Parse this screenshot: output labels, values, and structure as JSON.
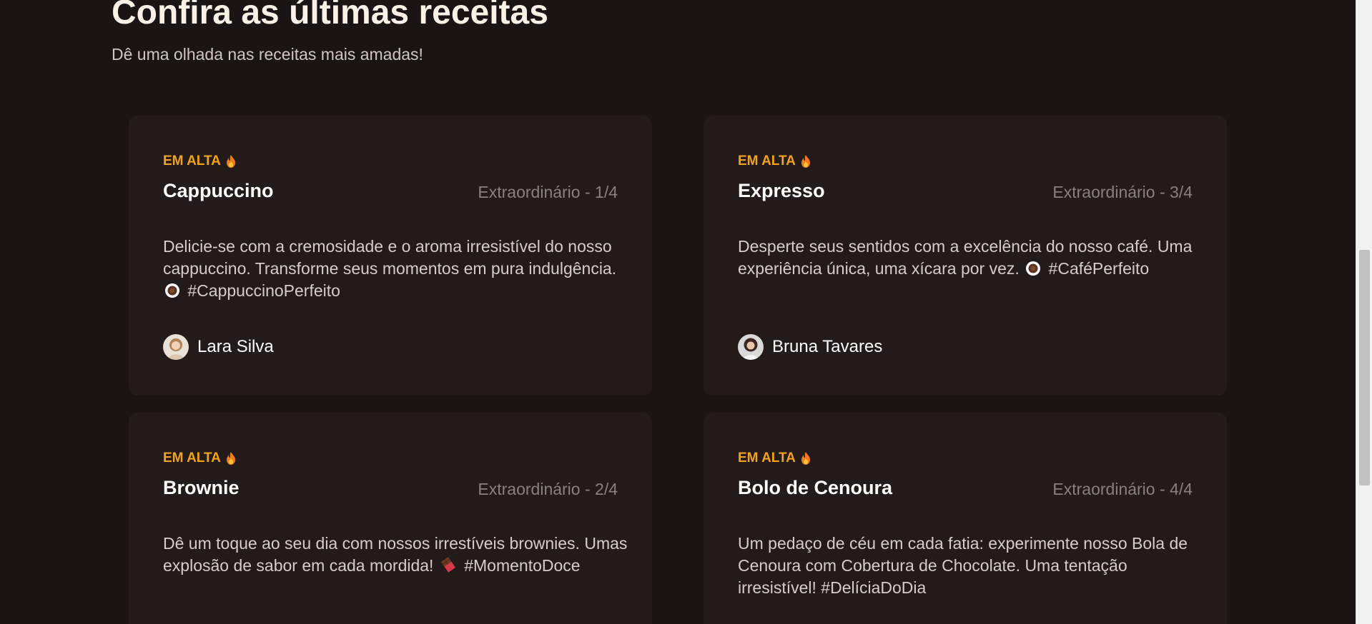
{
  "section": {
    "title": "Confira as últimas receitas",
    "subtitle": "Dê uma olhada nas receitas mais amadas!"
  },
  "colors": {
    "background": "#1b1414",
    "card": "#231a1a",
    "badge": "#f3a21a",
    "title": "#ffffff",
    "muted": "#8a8080"
  },
  "recipes": [
    {
      "badge": "EM ALTA",
      "badge_icon": "flame-icon",
      "title": "Cappuccino",
      "rating": "Extraordinário - 1/4",
      "description_start": "Delicie-se com a cremosidade e o aroma irresistível do nosso cappuccino. Transforme seus momentos em pura indulgência.",
      "emoji_icon": "coffee-cup-icon",
      "hashtag": "#CappuccinoPerfeito",
      "author": "Lara Silva"
    },
    {
      "badge": "EM ALTA",
      "badge_icon": "flame-icon",
      "title": "Expresso",
      "rating": "Extraordinário - 3/4",
      "description_start": "Desperte seus sentidos com a excelência do nosso café. Uma experiência única, uma xícara por vez.",
      "emoji_icon": "coffee-cup-icon",
      "hashtag": "#CaféPerfeito",
      "author": "Bruna Tavares"
    },
    {
      "badge": "EM ALTA",
      "badge_icon": "flame-icon",
      "title": "Brownie",
      "rating": "Extraordinário - 2/4",
      "description_start": "Dê um toque ao seu dia com nossos irrestíveis brownies. Umas explosão de sabor em cada mordida!",
      "emoji_icon": "chocolate-bar-icon",
      "hashtag": "#MomentoDoce"
    },
    {
      "badge": "EM ALTA",
      "badge_icon": "flame-icon",
      "title": "Bolo de Cenoura",
      "rating": "Extraordinário - 4/4",
      "description_start": "Um pedaço de céu em cada fatia: experimente nosso Bola de Cenoura com Cobertura de Chocolate. Uma tentação irresistível!",
      "hashtag": "#DelíciaDoDia"
    }
  ]
}
